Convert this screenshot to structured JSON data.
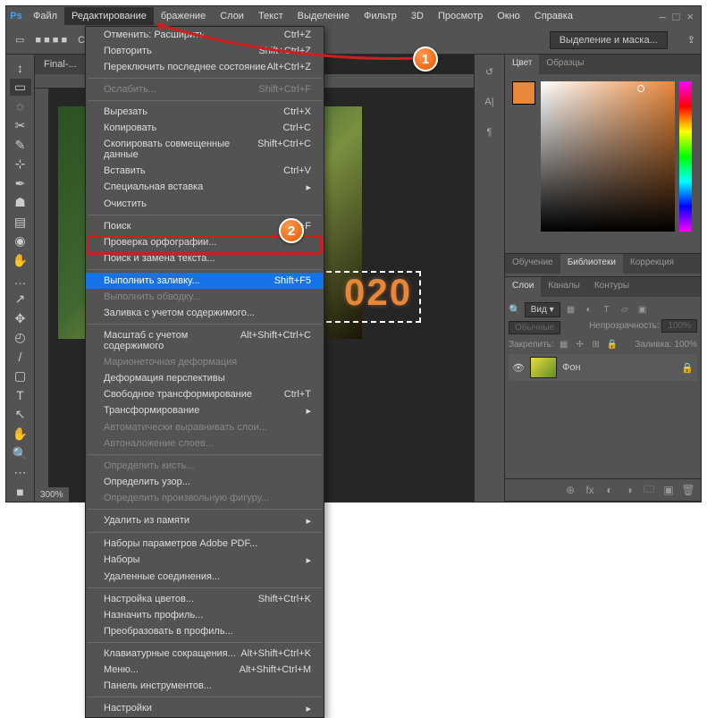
{
  "menu": {
    "items": [
      "Файл",
      "Редактирование",
      "бражение",
      "Слои",
      "Текст",
      "Выделение",
      "Фильтр",
      "3D",
      "Просмотр",
      "Окно",
      "Справка"
    ],
    "active_index": 1
  },
  "options": {
    "style_label": "Стиль:",
    "button_right": "Выделение и маска..."
  },
  "doc": {
    "tab": "Final-...",
    "zoom": "300%"
  },
  "canvas_text": "020",
  "color_panel": {
    "tabs": [
      "Цвет",
      "Образцы"
    ],
    "active": 0
  },
  "mid_panel": {
    "tabs": [
      "Обучение",
      "Библиотеки",
      "Коррекция"
    ],
    "active": 1
  },
  "layers_panel": {
    "tabs": [
      "Слои",
      "Каналы",
      "Контуры"
    ],
    "active": 0,
    "filter_label": "Вид",
    "blend": "Обычные",
    "opacity_label": "Непрозрачность:",
    "opacity": "100%",
    "lock_label": "Закрепить:",
    "fill_label": "Заливка:",
    "fill": "100%",
    "layer_name": "Фон"
  },
  "dropdown": [
    {
      "t": "item",
      "label": "Отменить: Расширить",
      "sc": "Ctrl+Z"
    },
    {
      "t": "item",
      "label": "Повторить",
      "sc": "Shift+Ctrl+Z"
    },
    {
      "t": "item",
      "label": "Переключить последнее состояние",
      "sc": "Alt+Ctrl+Z"
    },
    {
      "t": "sep"
    },
    {
      "t": "item",
      "label": "Ослабить...",
      "sc": "Shift+Ctrl+F",
      "d": true
    },
    {
      "t": "sep"
    },
    {
      "t": "item",
      "label": "Вырезать",
      "sc": "Ctrl+X"
    },
    {
      "t": "item",
      "label": "Копировать",
      "sc": "Ctrl+C"
    },
    {
      "t": "item",
      "label": "Скопировать совмещенные данные",
      "sc": "Shift+Ctrl+C"
    },
    {
      "t": "item",
      "label": "Вставить",
      "sc": "Ctrl+V"
    },
    {
      "t": "item",
      "label": "Специальная вставка",
      "sub": true
    },
    {
      "t": "item",
      "label": "Очистить"
    },
    {
      "t": "sep"
    },
    {
      "t": "item",
      "label": "Поиск",
      "sc": "Ctrl+F"
    },
    {
      "t": "item",
      "label": "Проверка орфографии..."
    },
    {
      "t": "item",
      "label": "Поиск и замена текста..."
    },
    {
      "t": "sep"
    },
    {
      "t": "item",
      "label": "Выполнить заливку...",
      "sc": "Shift+F5",
      "hl": true
    },
    {
      "t": "item",
      "label": "Выполнить обводку...",
      "d": true
    },
    {
      "t": "item",
      "label": "Заливка с учетом содержимого..."
    },
    {
      "t": "sep"
    },
    {
      "t": "item",
      "label": "Масштаб с учетом содержимого",
      "sc": "Alt+Shift+Ctrl+C"
    },
    {
      "t": "item",
      "label": "Марионеточная деформация",
      "d": true
    },
    {
      "t": "item",
      "label": "Деформация перспективы"
    },
    {
      "t": "item",
      "label": "Свободное трансформирование",
      "sc": "Ctrl+T"
    },
    {
      "t": "item",
      "label": "Трансформирование",
      "sub": true
    },
    {
      "t": "item",
      "label": "Автоматически выравнивать слои...",
      "d": true
    },
    {
      "t": "item",
      "label": "Автоналожение слоев...",
      "d": true
    },
    {
      "t": "sep"
    },
    {
      "t": "item",
      "label": "Определить кисть...",
      "d": true
    },
    {
      "t": "item",
      "label": "Определить узор..."
    },
    {
      "t": "item",
      "label": "Определить произвольную фигуру...",
      "d": true
    },
    {
      "t": "sep"
    },
    {
      "t": "item",
      "label": "Удалить из памяти",
      "sub": true
    },
    {
      "t": "sep"
    },
    {
      "t": "item",
      "label": "Наборы параметров Adobe PDF..."
    },
    {
      "t": "item",
      "label": "Наборы",
      "sub": true
    },
    {
      "t": "item",
      "label": "Удаленные соединения..."
    },
    {
      "t": "sep"
    },
    {
      "t": "item",
      "label": "Настройка цветов...",
      "sc": "Shift+Ctrl+K"
    },
    {
      "t": "item",
      "label": "Назначить профиль..."
    },
    {
      "t": "item",
      "label": "Преобразовать в профиль..."
    },
    {
      "t": "sep"
    },
    {
      "t": "item",
      "label": "Клавиатурные сокращения...",
      "sc": "Alt+Shift+Ctrl+K"
    },
    {
      "t": "item",
      "label": "Меню...",
      "sc": "Alt+Shift+Ctrl+M"
    },
    {
      "t": "item",
      "label": "Панель инструментов..."
    },
    {
      "t": "sep"
    },
    {
      "t": "item",
      "label": "Настройки",
      "sub": true
    }
  ],
  "markers": {
    "1": "1",
    "2": "2"
  }
}
